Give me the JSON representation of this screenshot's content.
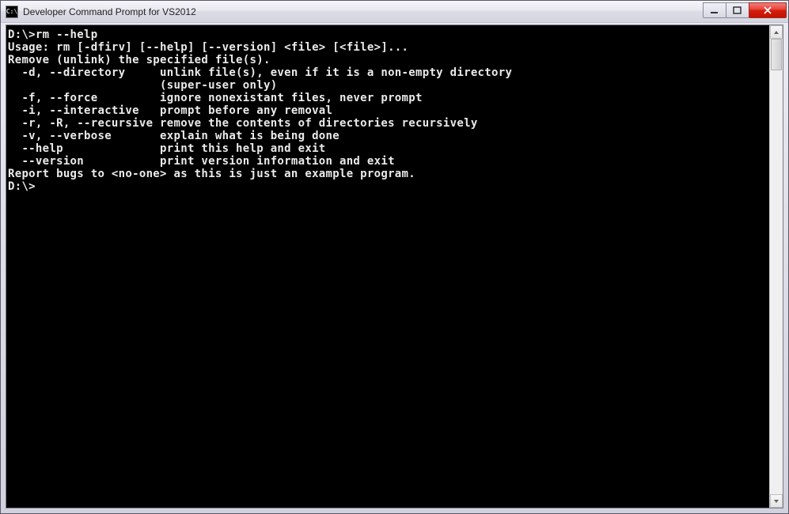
{
  "titlebar": {
    "icon_label": "C:\\",
    "title": "Developer Command Prompt for VS2012"
  },
  "terminal": {
    "lines": [
      "",
      "D:\\>rm --help",
      "Usage: rm [-dfirv] [--help] [--version] <file> [<file>]...",
      "Remove (unlink) the specified file(s).",
      "",
      "  -d, --directory     unlink file(s), even if it is a non-empty directory",
      "                      (super-user only)",
      "  -f, --force         ignore nonexistant files, never prompt",
      "  -i, --interactive   prompt before any removal",
      "  -r, -R, --recursive remove the contents of directories recursively",
      "  -v, --verbose       explain what is being done",
      "  --help              print this help and exit",
      "  --version           print version information and exit",
      "",
      "Report bugs to <no-one> as this is just an example program.",
      "",
      "D:\\>"
    ]
  }
}
